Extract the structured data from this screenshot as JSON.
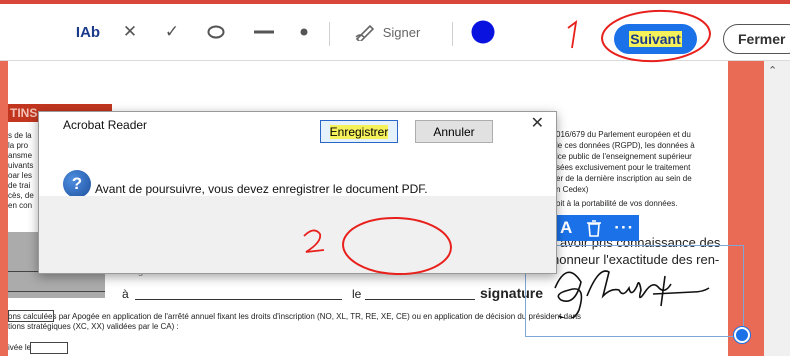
{
  "toolbar": {
    "text_tool": "IAb",
    "sign_label": "Signer",
    "accent_color": "#1b72e8",
    "next_button": "Suivant",
    "close_button": "Fermer"
  },
  "document": {
    "heading_fragment": "TINS",
    "left_col": [
      "s de la",
      "la pro",
      "ansme",
      "uivants",
      "oar les",
      "de trai",
      "cès, de",
      "en con"
    ],
    "right_col": [
      "016/679 du Parlement européen et du",
      "le ces données (RGPD), les données à",
      "ice public de l'enseignement supérieur",
      "sées exclusivement pour le traitement",
      "er de la dernière inscription au sein de",
      "n Cedex)",
      "oit à la portabilité de vos données."
    ],
    "connaissance": "avoir pris connaissance des",
    "exactitude": "honneur l'exactitude des ren-",
    "partial_line": "seignements fournis ci-dessus.",
    "place_prefix": "à",
    "date_prefix": "le",
    "signature_label": "signature",
    "footer_line1": "ons calculées par Apogée en application de l'arrêté annuel fixant les droits d'inscription (NO, XL, TR, RE, XE, CE) ou en application de décision du président dans",
    "footer_line2": "tions stratégiques (XC, XX) validées par le CA) :",
    "footer_line3": "ivée le"
  },
  "dialog": {
    "title": "Acrobat Reader",
    "message": "Avant de poursuivre, vous devez enregistrer le document PDF.",
    "save_button": "Enregistrer",
    "cancel_button": "Annuler"
  },
  "annotations": {
    "step1": "1",
    "step2": "2",
    "annotation_color": "#e8201c"
  }
}
